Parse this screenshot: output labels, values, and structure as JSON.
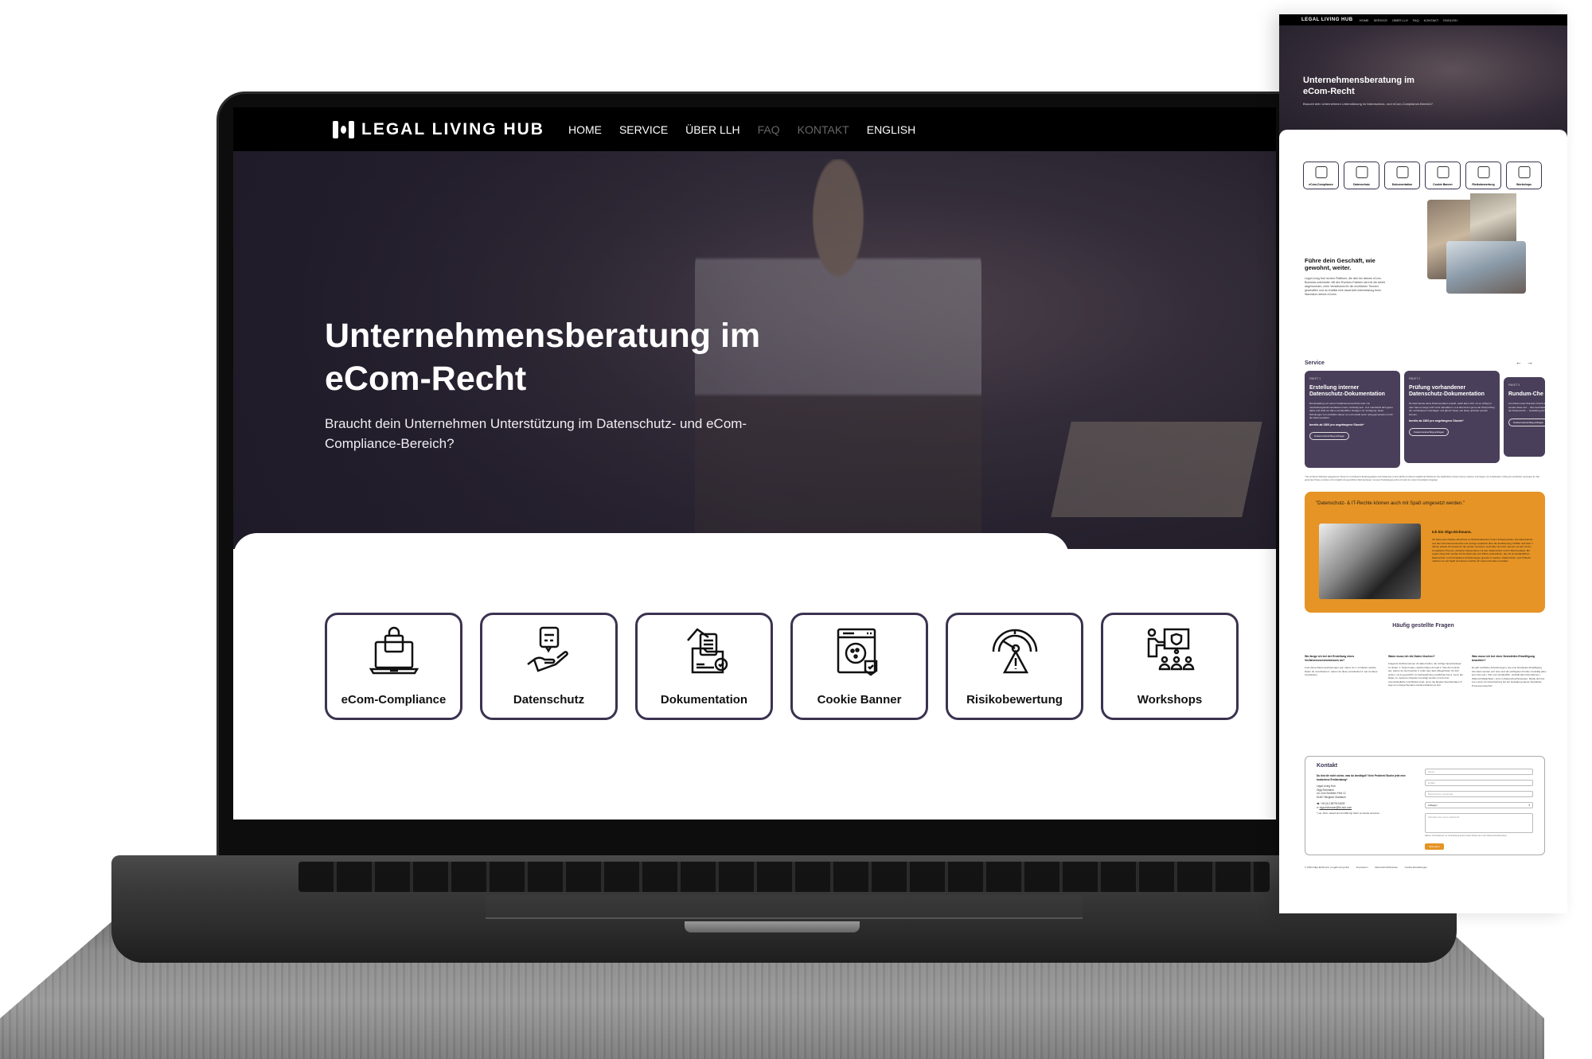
{
  "site": {
    "logo_text": "LEGAL LIVING HUB",
    "nav": [
      {
        "label": "HOME"
      },
      {
        "label": "SERVICE"
      },
      {
        "label": "ÜBER LLH"
      },
      {
        "label": "FAQ"
      },
      {
        "label": "KONTAKT"
      },
      {
        "label": "ENGLISH"
      }
    ],
    "hero": {
      "title": "Unternehmensberatung im eCom-Recht",
      "subtitle": "Braucht dein Unternehmen Unterstützung im Datenschutz- und eCom-Compliance-Bereich?"
    },
    "services": [
      {
        "label": "eCom-Compliance",
        "icon": "laptop-bag-icon"
      },
      {
        "label": "Datenschutz",
        "icon": "hand-chat-icon"
      },
      {
        "label": "Dokumentation",
        "icon": "folder-documents-icon"
      },
      {
        "label": "Cookie Banner",
        "icon": "cookie-browser-icon"
      },
      {
        "label": "Risikobewertung",
        "icon": "gauge-warning-icon"
      },
      {
        "label": "Workshops",
        "icon": "presentation-icon"
      }
    ]
  },
  "page": {
    "about": {
      "title": "Führe dein Geschäft, wie gewohnt, weiter.",
      "text": "Legal Living Hub ist eine Plattform, die dich bei deinem eCom-Business unterstützt. Mit den Rundum-Paketen wird dir die Arbeit abgenommen, mehr Verständnis für die rechtlichen Themen geschaffen und du erhältst eine dauerhaft Unterstützung beim Wachstum deines eComs."
    },
    "service_section": {
      "title": "Service",
      "prev": "←",
      "next": "→",
      "packages": [
        {
          "kicker": "PAKET 1",
          "title": "Erstellung interner Datenschutz-Dokumentation",
          "text": "Die Erstellung von einem Verfahrensverzeichnis oder von Verarbeitungsdokumentationen kann mühselig sein. LLH unterstützt dich gerne dabei und stellt vor Allem verständliche Vorlagen zur Verfügung, bietet Schulungen zum Ausfüllen dieser an und erstellt wenn nötig gemeinsam mit dir die Dokumentation.",
          "price": "bereits ab 180€ pro angefangene Stunde*",
          "button": "Kostenvoranschlag anfragen"
        },
        {
          "kicker": "PAKET 2",
          "title": "Prüfung vorhandener Datenschutz-Dokumentation",
          "text": "Du hast bereits deine Dokumentation erstellt, weißt aber nicht, ob es richtig ist oder hast es lange nicht mehr aktualisiert. LLH übernimmt gerne die Überprüfung der vorhandenen Unterlagen und gibt dir Tipps, wie diese optimiert werden können.",
          "price": "bereits ab 180€ pro angefangene Stunde*",
          "button": "Kostenvoranschlag anfragen"
        },
        {
          "kicker": "PAKET 3",
          "title": "Rundum-Che",
          "text": "LLH bietet einen Rundum-Check deiner Website/Apps. Dabei werden diese auf ... dies beinhaltet unter anderem ... Impressums, der Datenschutz ... Gestaltung der Website/Ap...",
          "price": "",
          "button": "Kostenvoranschlag anfragen"
        }
      ],
      "footnote": "* Die auf dieser Webseite angegebenen Preise für verschiedene Beratungspakete sind Nettopreise in Euro (EUR) und dienen lediglich als Richtwerte. Die tatsächlichen Kosten können variieren und hängen vom individuellen Umfang der erbrachten Leistungen ab. Alle genannten Preise verstehen sich zuzüglich der gesetzlichen Mehrwertsteuer. Genaue Preisfestlegung wird erst nach der ersten Konsultation festgelegt."
    },
    "quote": {
      "text": "\"Datenschutz- & IT-Rechte können auch mit Spaß umgesetzt werden.\"",
      "name": "Ich bin Olga Eichmann.",
      "bio": "Ich habe einen Master-Abschluss im Wirtschaftsrecht mit den Schwerpunkten des Datenschutz- und des Unternehmensrechts und verfüge zusätzlich über die Zertifizierung CIPP/E. Seit über 7 Jahren arbeite ich bereits für die großen Konzerne und habe mich dort intensiv mit den eCom-Compliance-Themen, darunter insbesondere mit dem Datenschutz und IT-Recht befasst. Mit Legal Living Hub möchte ich die Start-Ups und KMUs unterstützen, den oft unverständlichen Datenschutz- und Compliance-Anforderungen gerecht zu werden. Datenschutz- und IT-Recht machen mir viel Spaß und diesen möchte ich meinen Kunden vermitteln."
    },
    "faq": {
      "title": "Häufig gestellte Fragen",
      "items": [
        {
          "q": "Wo fange ich bei der Erstellung eines Verfahrensverzeichnisses an?",
          "a": "Liste deine Datenverarbeitungen auf, indem du 1. ermittelst, welche Daten du verarbeitest 2. warum du diese verarbeitest 3. wie du diese verarbeitest"
        },
        {
          "q": "Wann muss ich die Daten löschen?",
          "a": "Folgende Schritte können dir dabei helfen, die richtige Speicherdauer zu finden: 1. finde heraus, welche Daten du hast 2. liste die Gründe auf, warum du sie brauchst 3. prüfe oder lass Ablegefristen für dich prüfen, ob du gesetzlich zur Aufbewahrung verpflichtet bist 4. wenn die Daten zu mehreren Zwecken benötigt werden und du hier unterschiedliche Löschfristen hast, nimm die längste Speicherdauer 5. lege ein entsprechendes Löschmechanismus fest"
        },
        {
          "q": "Was muss ich bei einer Newsletter-Einwilligung beachten?",
          "a": "Es gibt rechtliche Anforderungen, wie eine Newsletter-Einwilligung formuliert werden soll. Hier sind die wichtigsten Punkte: Freiwillig (also kein Opt-out) • Klar und verständlich • Enthält alle Informationen • Widerruf Möglichkeit • Link zu Datenschutzhinweisen. Melde dich bei LLH, wenn du Unterstützung bei der Gestaltung deiner Newsletter-Prozesse brauchst!"
        }
      ]
    },
    "contact": {
      "title": "Kontakt",
      "lead": "Du bist dir nicht sicher, was du benötigst? Kein Problem! Buche jetzt eine kostenlose Erstberatung*.",
      "address": [
        "Legal Living Hub",
        "Olga Eichmann",
        "c/o Zum Scheider Feld 12",
        "51467 Bergisch Gladbach"
      ],
      "phone": "+49 (0) 15679131603",
      "email": "olga.eichmann@llh-hub.com",
      "note": "* max. 30min, danach wird mit 180€ zzgl. MwSt. pro Stunde verrechnet",
      "form": {
        "name_placeholder": "Name",
        "email_placeholder": "E-Mail",
        "booking_placeholder": "Buchnummer (optional)",
        "select_value": "Anliegen",
        "message_placeholder": "Schreibe hier deine Nachricht",
        "privacy_note": "Nähere Informationen zur Verarbeitung deiner Daten findest du in den Datenschutzhinweisen.",
        "submit": "Absenden"
      }
    },
    "footer": {
      "copyright": "© 2024 Olga Eichmann | Legal Living Hub",
      "links": [
        "Impressum",
        "Datenschutzhinweise",
        "Cookie-Einstellungen"
      ]
    }
  }
}
